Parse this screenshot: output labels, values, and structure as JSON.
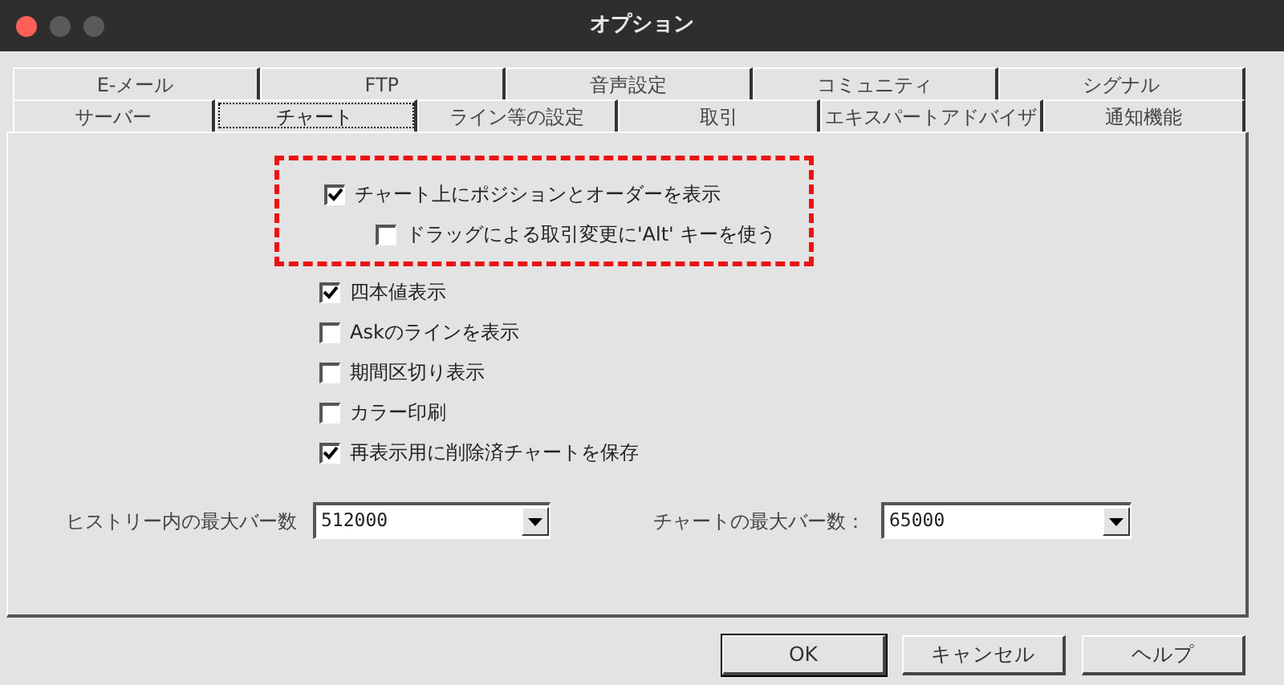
{
  "window": {
    "title": "オプション"
  },
  "tab_rows": [
    [
      {
        "label": "E-メール",
        "selected": false
      },
      {
        "label": "FTP",
        "selected": false
      },
      {
        "label": "音声設定",
        "selected": false
      },
      {
        "label": "コミュニティ",
        "selected": false
      },
      {
        "label": "シグナル",
        "selected": false
      }
    ],
    [
      {
        "label": "サーバー",
        "selected": false
      },
      {
        "label": "チャート",
        "selected": true
      },
      {
        "label": "ライン等の設定",
        "selected": false
      },
      {
        "label": "取引",
        "selected": false
      },
      {
        "label": "エキスパートアドバイザ",
        "selected": false
      },
      {
        "label": "通知機能",
        "selected": false
      }
    ]
  ],
  "options": [
    {
      "label": "チャート上にポジションとオーダーを表示",
      "checked": true,
      "highlighted": true,
      "children": [
        {
          "label": "ドラッグによる取引変更に'Alt' キーを使う",
          "checked": false
        }
      ]
    },
    {
      "label": "四本値表示",
      "checked": true,
      "highlighted": false
    },
    {
      "label": "Askのラインを表示",
      "checked": false,
      "highlighted": false
    },
    {
      "label": "期間区切り表示",
      "checked": false,
      "highlighted": false
    },
    {
      "label": "カラー印刷",
      "checked": false,
      "highlighted": false
    },
    {
      "label": "再表示用に削除済チャートを保存",
      "checked": true,
      "highlighted": false
    }
  ],
  "dropdowns": [
    {
      "label": "ヒストリー内の最大バー数",
      "value": "512000"
    },
    {
      "label": "チャートの最大バー数：",
      "value": "65000"
    }
  ],
  "buttons": [
    {
      "label": "OK",
      "selected": true
    },
    {
      "label": "キャンセル",
      "selected": false
    },
    {
      "label": "ヘルプ",
      "selected": false
    }
  ]
}
